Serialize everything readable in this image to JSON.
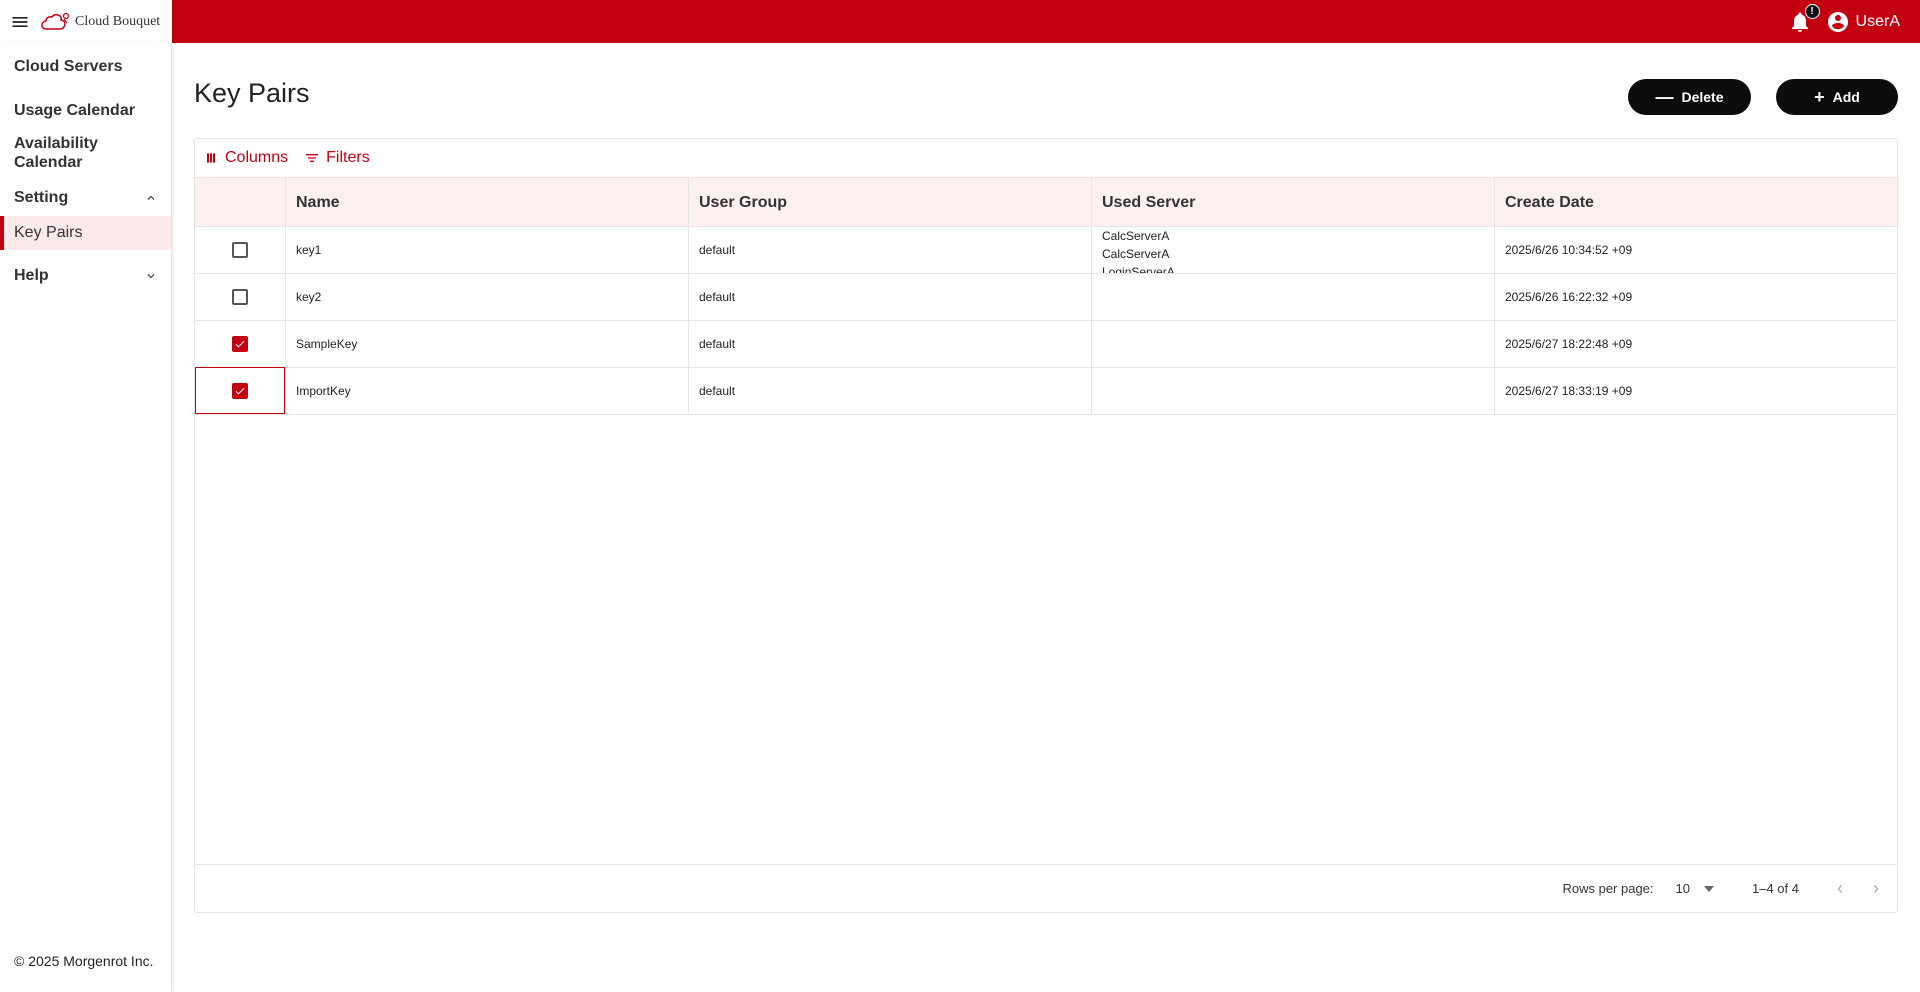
{
  "app": {
    "logo_text": "Cloud Bouquet",
    "accent_color": "#c30012"
  },
  "header": {
    "notification_badge": "!",
    "user_name": "UserA"
  },
  "sidebar": {
    "items": [
      {
        "label": "Cloud Servers"
      },
      {
        "label": "Usage Calendar"
      },
      {
        "label": "Availability Calendar"
      }
    ],
    "setting": {
      "label": "Setting",
      "expanded": true,
      "children": [
        {
          "label": "Key Pairs",
          "active": true
        }
      ]
    },
    "help": {
      "label": "Help",
      "expanded": false
    },
    "copyright": "© 2025 Morgenrot Inc."
  },
  "main": {
    "title": "Key Pairs",
    "buttons": {
      "delete": "Delete",
      "add": "Add"
    },
    "toolbar": {
      "columns": "Columns",
      "filters": "Filters"
    },
    "columns": [
      "Name",
      "User Group",
      "Used Server",
      "Create Date"
    ],
    "rows": [
      {
        "checked": false,
        "name": "key1",
        "user_group": "default",
        "used_server": [
          "CalcServerA",
          "CalcServerA",
          "LoginServerA"
        ],
        "create_date": "2025/6/26 10:34:52 +09"
      },
      {
        "checked": false,
        "name": "key2",
        "user_group": "default",
        "used_server": [],
        "create_date": "2025/6/26 16:22:32 +09"
      },
      {
        "checked": true,
        "name": "SampleKey",
        "user_group": "default",
        "used_server": [],
        "create_date": "2025/6/27 18:22:48 +09"
      },
      {
        "checked": true,
        "name": "ImportKey",
        "user_group": "default",
        "used_server": [],
        "create_date": "2025/6/27 18:33:19 +09"
      }
    ],
    "pagination": {
      "rows_per_page_label": "Rows per page:",
      "rows_per_page": "10",
      "range": "1–4 of 4"
    }
  }
}
